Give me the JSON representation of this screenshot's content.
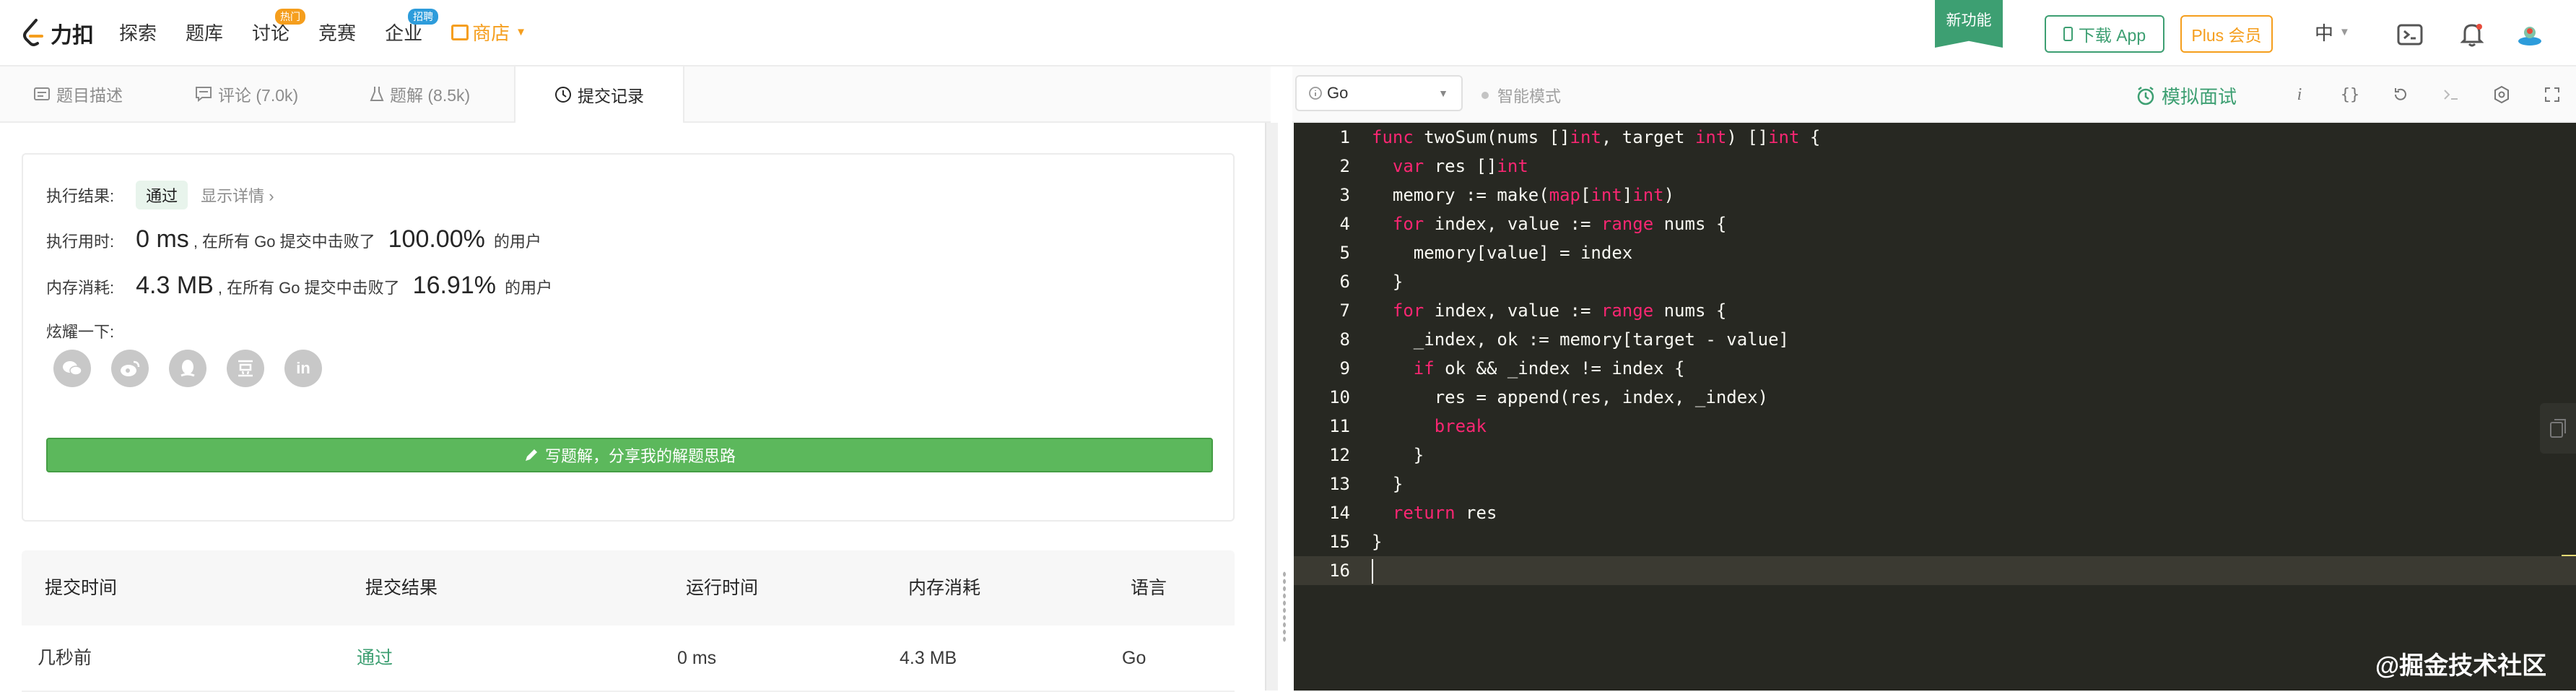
{
  "brand": {
    "name": "力扣"
  },
  "nav": {
    "items": [
      {
        "label": "探索"
      },
      {
        "label": "题库"
      },
      {
        "label": "讨论",
        "badge": "热门",
        "badge_color": "#f59e1d"
      },
      {
        "label": "竞赛"
      },
      {
        "label": "企业",
        "badge": "招聘",
        "badge_color": "#2d9cdb"
      }
    ],
    "store": "商店"
  },
  "topbar": {
    "new_feature": "新功能",
    "download_app": "下载 App",
    "plus": "Plus 会员",
    "language": "中"
  },
  "left_tabs": [
    {
      "label": "题目描述",
      "icon": "description-icon"
    },
    {
      "label": "评论 (7.0k)",
      "icon": "comment-icon"
    },
    {
      "label": "题解 (8.5k)",
      "icon": "flask-icon"
    },
    {
      "label": "提交记录",
      "icon": "clock-icon",
      "active": true
    }
  ],
  "result": {
    "label": "执行结果:",
    "status": "通过",
    "show_detail": "显示详情 ›",
    "runtime_label": "执行用时:",
    "runtime_value": "0 ms",
    "runtime_text": ", 在所有 Go 提交中击败了",
    "runtime_percent": "100.00%",
    "runtime_suffix": "的用户",
    "memory_label": "内存消耗:",
    "memory_value": "4.3 MB",
    "memory_text": ", 在所有 Go 提交中击败了",
    "memory_percent": "16.91%",
    "memory_suffix": "的用户",
    "share_label": "炫耀一下:",
    "share_icons": [
      "wechat-icon",
      "weibo-icon",
      "qq-icon",
      "douban-icon",
      "linkedin-icon"
    ],
    "solution_button": "写题解，分享我的解题思路"
  },
  "submissions": {
    "headers": [
      "提交时间",
      "提交结果",
      "运行时间",
      "内存消耗",
      "语言"
    ],
    "rows": [
      {
        "time": "几秒前",
        "result": "通过",
        "runtime": "0 ms",
        "memory": "4.3 MB",
        "lang": "Go"
      }
    ]
  },
  "editor_toolbar": {
    "language": "Go",
    "smart_mode": "智能模式",
    "mock_interview": "模拟面试",
    "tools": [
      "info-icon",
      "braces-icon",
      "reset-icon",
      "console-icon",
      "settings-icon",
      "fullscreen-icon"
    ]
  },
  "code": [
    "func twoSum(nums []int, target int) []int {",
    "  var res []int",
    "  memory := make(map[int]int)",
    "  for index, value := range nums {",
    "    memory[value] = index",
    "  }",
    "  for index, value := range nums {",
    "    _index, ok := memory[target - value]",
    "    if ok && _index != index {",
    "      res = append(res, index, _index)",
    "      break",
    "    }",
    "  }",
    "  return res",
    "}",
    ""
  ],
  "watermark": "@掘金技术社区",
  "colors": {
    "accent": "#3d9f72",
    "plus": "#f59e1d",
    "keyword": "#f92672",
    "editor_bg": "#272822"
  }
}
